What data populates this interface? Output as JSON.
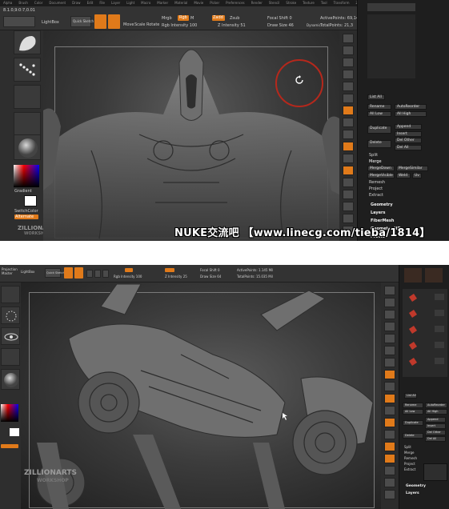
{
  "top_screenshot": {
    "menu": [
      "Alpha",
      "Brush",
      "Color",
      "Document",
      "Draw",
      "Edit",
      "File",
      "Layer",
      "Light",
      "Macro",
      "Marker",
      "Material",
      "Movie",
      "Picker",
      "Preferences",
      "Render",
      "Stencil",
      "Stroke",
      "Texture",
      "Tool",
      "Transform",
      "Zplugin",
      "Zscript"
    ],
    "counter": "8.1.0,9:0:7,0.01",
    "toolbar": {
      "lightbox": "LightBox",
      "quick_sketch": "Quick Sketch",
      "edit": "Edit",
      "draw": "Draw",
      "move": "Move",
      "scale": "Scale",
      "rotate": "Rotate",
      "mrgb": "Mrgb",
      "rgb": "Rgb",
      "m": "M",
      "rgb_intensity": "Rgb Intensity 100",
      "zadd": "Zadd",
      "zsub": "Zsub",
      "z_intensity": "Z Intensity 51",
      "focal_shift": "Focal Shift 0",
      "draw_size": "Draw Size 46",
      "dynamic": "Dynamic",
      "active_points": "ActivePoints: 69,142",
      "total_points": "TotalPoints: 21,3"
    },
    "left": {
      "projection_master": "Projection Master",
      "gradient": "Gradient",
      "switch_color": "SwitchColor",
      "alternate": "Alternate"
    },
    "palette": {
      "list_all": "List All",
      "rename": "Rename",
      "auto_reorder": "AutoReorder",
      "all_low": "All Low",
      "all_high": "All High",
      "duplicate": "Duplicate",
      "append": "Append",
      "insert": "Insert",
      "delete": "Delete",
      "del_other": "Del Other",
      "del_all": "Del All",
      "split": "Split",
      "merge": "Merge",
      "merge_down": "MergeDown",
      "merge_similar": "MergeSimilar",
      "merge_visible": "MergeVisible",
      "weld": "Weld",
      "uv": "Uv",
      "remesh": "Remesh",
      "project": "Project",
      "extract": "Extract",
      "geometry": "Geometry",
      "layers": "Layers",
      "fibermesh": "FiberMesh",
      "geometry_hd": "Geometry HD",
      "preview": "Preview"
    },
    "logo_line1": "ZILLIONARTS",
    "logo_line2": "WORKSHOP"
  },
  "bottom_screenshot": {
    "toolbar": {
      "projection_master": "Projection Master",
      "lightbox": "LightBox",
      "quick_sketch": "Quick Sketch",
      "rgb_intensity": "Rgb Intensity 100",
      "z_intensity": "Z Intensity 25",
      "focal_shift": "Focal Shift 0",
      "draw_size": "Draw Size 64",
      "active_points": "ActivePoints: 1.145 Mil",
      "total_points": "TotalPoints: 15.035 Mil"
    },
    "palette": {
      "list_all": "List All",
      "rename": "Rename",
      "auto_reorder": "AutoReorder",
      "all_low": "All Low",
      "all_high": "All High",
      "duplicate": "Duplicate",
      "append": "Append",
      "insert": "Insert",
      "delete": "Delete",
      "del_other": "Del Other",
      "del_all": "Del All",
      "split": "Split",
      "merge": "Merge",
      "remesh": "Remesh",
      "project": "Project",
      "extract": "Extract",
      "geometry": "Geometry",
      "layers": "Layers"
    },
    "logo_line1": "ZILLIONARTS",
    "logo_line2": "WORKSHOP",
    "watermark": "NUKE交流吧 【www.linecg.com/tieba/1814】"
  },
  "colors": {
    "accent": "#e07a1a",
    "cursor_ring": "#b5281c",
    "background": "#2a2a2a"
  }
}
